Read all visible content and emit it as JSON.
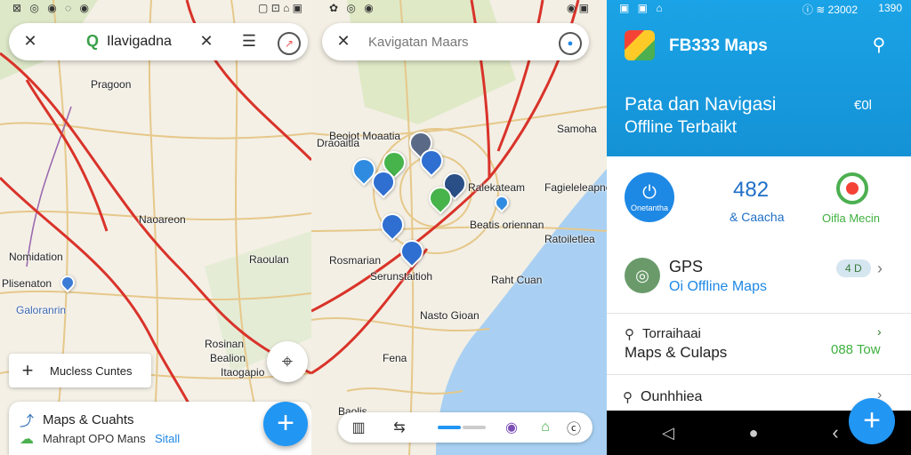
{
  "left_panel": {
    "status_left": "⊠ ◎ ◉ ◌ ◉",
    "status_right": "▢ ⊡ ⌂ ▣",
    "search_text": "Ilavigadna",
    "map_labels": [
      "Pragoon",
      "Naoareon",
      "Nomidation",
      "Plisenaton",
      "Galoranrin",
      "Raoulan",
      "Rosinan",
      "Bealion",
      "Itaogapio"
    ],
    "layers_label": "Mucless Cuntes",
    "bottom_title": "Maps & Cuahts",
    "bottom_sub": "Mahrapt OPO Mans",
    "bottom_tag": "Sitall"
  },
  "middle_panel": {
    "search_placeholder": "Kavigatan Maars",
    "map_labels": [
      "Beoiot Moaatia",
      "Draoaitla",
      "Samoha",
      "Ralekateam",
      "Fagieleleapne",
      "Beatis oriennan",
      "Ratoiletlea",
      "Rosmarian",
      "Serunstaitioh",
      "Raht Cuan",
      "Nasto Gioan",
      "Fena",
      "Baolis"
    ],
    "bottom_nav": [
      "▥",
      "⇆",
      "",
      "◉",
      "⌂",
      "ⓒ"
    ]
  },
  "right_panel": {
    "status_left": "▣ ▣ ⌂",
    "status_right": "ⓘ ≋ 23002",
    "status_time": "1390",
    "app_title": "FB333 Maps",
    "headline_1": "Pata dan Navigasi",
    "headline_2": "Offline Terbaikt",
    "header_badge": "€0l",
    "stat_1_label": "Onetantha",
    "stat_2_value": "482",
    "stat_2_label": "& Caacha",
    "stat_3_label": "Oifla Mecin",
    "gps_title": "GPS",
    "gps_sub": "Oi Offline Maps",
    "gps_badge": "4 D",
    "row2_small": "Torraihaai",
    "row2_title": "Maps & Culaps",
    "row2_value": "088 Tow",
    "row3_title": "Ounhhiea",
    "nav": [
      "◁",
      "●",
      "‹"
    ],
    "colors": {
      "primary": "#1aa3e6",
      "accent": "#2196f3",
      "green": "#3fb03f"
    }
  }
}
